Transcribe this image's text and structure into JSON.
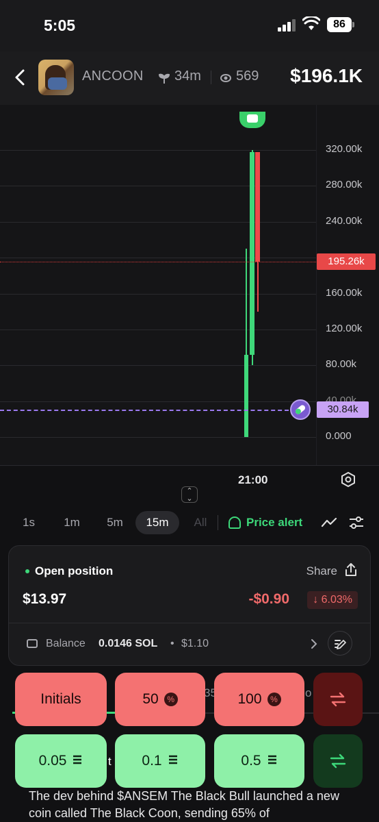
{
  "status_bar": {
    "time": "5:05",
    "battery": "86"
  },
  "header": {
    "ticker": "ANCOON",
    "age": "34m",
    "viewers": "569",
    "market_cap": "$196.1K"
  },
  "chart": {
    "y_labels": [
      "320.00k",
      "280.00k",
      "240.00k",
      "160.00k",
      "120.00k",
      "80.00k",
      "40.00k",
      "0.000"
    ],
    "current_price_tag": "195.26k",
    "entry_price_tag": "30.84k",
    "x_label": "21:00"
  },
  "chart_data": {
    "type": "candlestick",
    "y_axis_labels": [
      "0.000",
      "40.00k",
      "80.00k",
      "120.00k",
      "160.00k",
      "240.00k",
      "280.00k",
      "320.00k"
    ],
    "ylim": [
      0,
      320000
    ],
    "x_tick": "21:00",
    "candles": [
      {
        "open": 0,
        "close": 92000,
        "high": 210000,
        "low": 0,
        "color": "green"
      },
      {
        "open": 92000,
        "close": 318000,
        "high": 320000,
        "low": 80000,
        "color": "green"
      },
      {
        "open": 318000,
        "close": 195260,
        "high": 312000,
        "low": 140000,
        "color": "red"
      }
    ],
    "current_price": 195260,
    "entry_price": 30840
  },
  "timeframes": {
    "items": [
      "1s",
      "1m",
      "5m",
      "15m",
      "All"
    ],
    "active": "15m",
    "price_alert": "Price alert"
  },
  "position": {
    "title": "Open position",
    "share": "Share",
    "value": "$13.97",
    "pnl": "-$0.90",
    "pnl_pct": "↓ 6.03%",
    "balance_label": "Balance",
    "balance_sol": "0.0146 SOL",
    "balance_dot": "•",
    "balance_usd": "$1.10"
  },
  "sell_buttons": {
    "initials": "Initials",
    "fifty": "50",
    "hundred": "100"
  },
  "buy_buttons": {
    "a": "0.05",
    "b": "0.1",
    "c": "0.5"
  },
  "ghost_text": {
    "left": "35",
    "right": "o",
    "under": "t"
  },
  "description": "The dev behind $ANSEM The Black Bull launched a new coin called The Black Coon, sending 65% of",
  "colors": {
    "accent_green": "#3dd87a",
    "accent_red": "#f47272",
    "entry_purple": "#c8a3f5"
  }
}
